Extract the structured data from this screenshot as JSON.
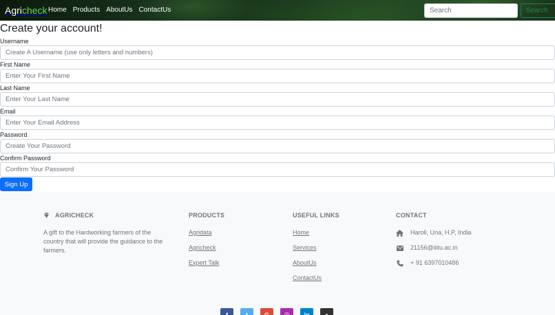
{
  "navbar": {
    "brand_part1": "Agri",
    "brand_part2": "check",
    "links": [
      "Home",
      "Products",
      "AboutUs",
      "ContactUs"
    ],
    "search_placeholder": "Search",
    "search_button": "Search"
  },
  "form": {
    "title": "Create your account!",
    "fields": [
      {
        "label": "Username",
        "placeholder": "Create A Username (use only letters and numbers)"
      },
      {
        "label": "First Name",
        "placeholder": "Enter Your First Name"
      },
      {
        "label": "Last Name",
        "placeholder": "Enter Your Last Name"
      },
      {
        "label": "Email",
        "placeholder": "Enter Your Email Address"
      },
      {
        "label": "Password",
        "placeholder": "Create Your Password"
      },
      {
        "label": "Confirm Password",
        "placeholder": "Confirm Your Password"
      }
    ],
    "submit": "Sign Up"
  },
  "footer": {
    "brand": "AGRICHECK",
    "tagline": "A gift to the Hardworking farmers of the country that will provide the guidance to the farmers.",
    "products_heading": "PRODUCTS",
    "products": [
      "Agridata",
      "Agricheck",
      "Expert Talk"
    ],
    "links_heading": "USEFUL LINKS",
    "links": [
      "Home",
      "Services",
      "AboutUs",
      "ContactUs"
    ],
    "contact_heading": "CONTACT",
    "address": "Haroli, Una, H.P, India",
    "email": "21156@iiitu.ac.in",
    "phone": "+ 91 6397010486",
    "social_icons": [
      "facebook-icon",
      "twitter-icon",
      "google-icon",
      "instagram-icon",
      "linkedin-icon",
      "github-icon"
    ],
    "colors": {
      "facebook": "#3b5998",
      "twitter": "#55acee",
      "google": "#dd4b39",
      "instagram": "#ac2bac",
      "linkedin": "#0082ca",
      "github": "#333333"
    }
  },
  "colors": {
    "primary": "#0d6efd",
    "brand_accent": "#5fd85f",
    "search_outline": "#198754",
    "footer_bg": "#f8f9fa",
    "footer_text": "#6c757d"
  }
}
